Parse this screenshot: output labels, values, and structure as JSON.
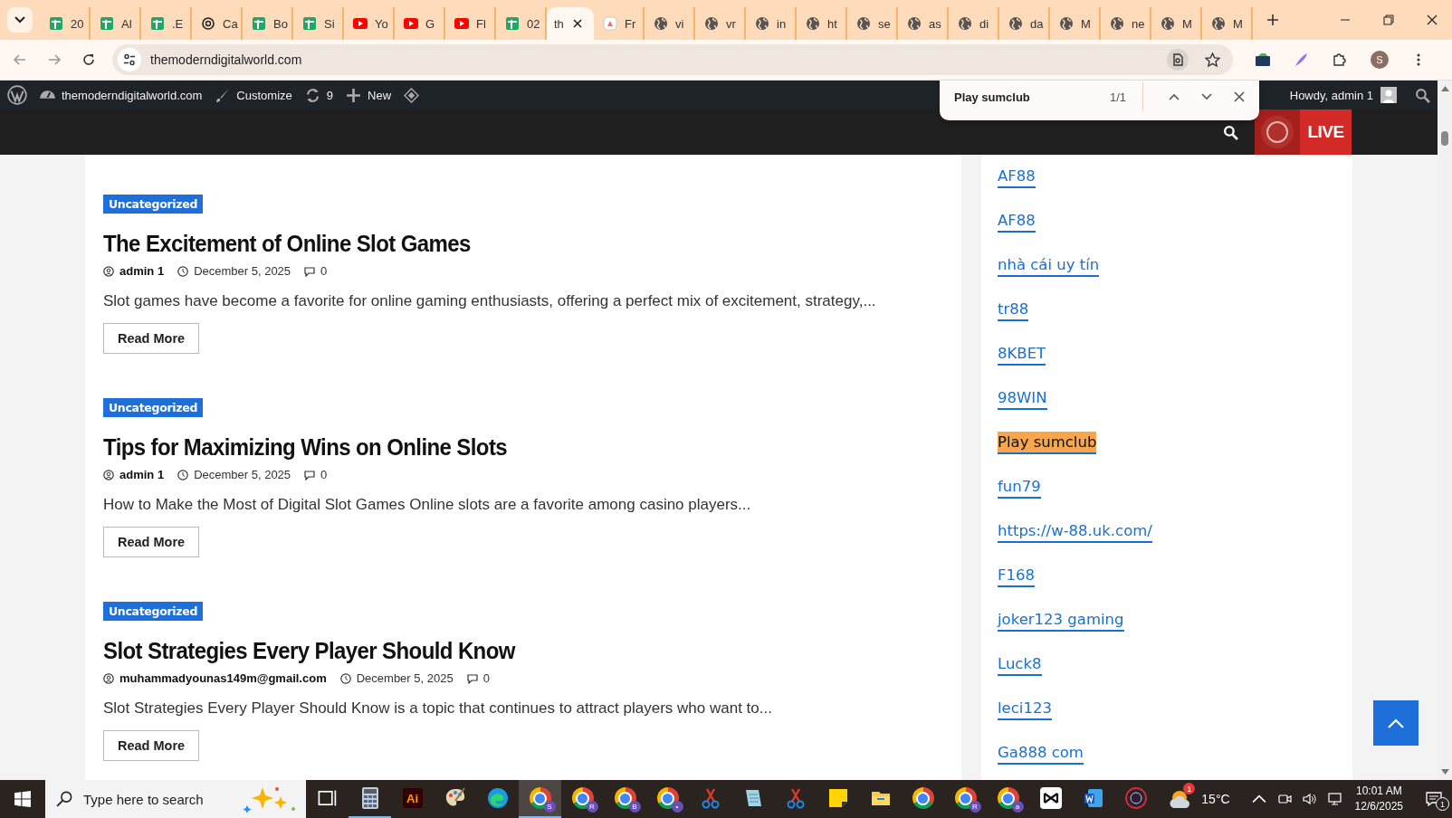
{
  "tabs": [
    {
      "kind": "sheets",
      "label": "20",
      "selected": false
    },
    {
      "kind": "sheets",
      "label": "Al",
      "selected": false
    },
    {
      "kind": "sheets",
      "label": ".E",
      "selected": false
    },
    {
      "kind": "knot",
      "label": "Ca",
      "selected": false
    },
    {
      "kind": "sheets",
      "label": "Bo",
      "selected": false
    },
    {
      "kind": "sheets",
      "label": "Si",
      "selected": false
    },
    {
      "kind": "video",
      "label": "Yo",
      "selected": false
    },
    {
      "kind": "video",
      "label": "G",
      "selected": false
    },
    {
      "kind": "video",
      "label": "Fl",
      "selected": false
    },
    {
      "kind": "sheets",
      "label": "02",
      "selected": false
    },
    {
      "kind": "page",
      "label": "th",
      "selected": true
    },
    {
      "kind": "doc",
      "label": "Fr",
      "selected": false
    },
    {
      "kind": "globe",
      "label": "vi",
      "selected": false
    },
    {
      "kind": "globe",
      "label": "vr",
      "selected": false
    },
    {
      "kind": "globe",
      "label": "in",
      "selected": false
    },
    {
      "kind": "globe",
      "label": "ht",
      "selected": false
    },
    {
      "kind": "globe",
      "label": "se",
      "selected": false
    },
    {
      "kind": "globe",
      "label": "as",
      "selected": false
    },
    {
      "kind": "globe",
      "label": "di",
      "selected": false
    },
    {
      "kind": "globe",
      "label": "da",
      "selected": false
    },
    {
      "kind": "globe",
      "label": "M",
      "selected": false
    },
    {
      "kind": "globe",
      "label": "ne",
      "selected": false
    },
    {
      "kind": "globe",
      "label": "M",
      "selected": false
    },
    {
      "kind": "globe",
      "label": "M",
      "selected": false
    }
  ],
  "address": {
    "url": "themoderndigitalworld.com",
    "profile_initial": "S"
  },
  "find_bar": {
    "query": "Play sumclub",
    "count": "1/1"
  },
  "admin_bar": {
    "site": "themoderndigitalworld.com",
    "customize": "Customize",
    "updates": "9",
    "new": "New",
    "greeting": "Howdy, admin 1"
  },
  "header": {
    "live": "LIVE"
  },
  "posts": [
    {
      "category": "Uncategorized",
      "title": "The Excitement of Online Slot Games",
      "author": "admin 1",
      "date": "December 5, 2025",
      "comments": "0",
      "excerpt": "Slot games have become a favorite for online gaming enthusiasts, offering a perfect mix of excitement, strategy,...",
      "button": "Read More"
    },
    {
      "category": "Uncategorized",
      "title": "Tips for Maximizing Wins on Online Slots",
      "author": "admin 1",
      "date": "December 5, 2025",
      "comments": "0",
      "excerpt": "How to Make the Most of Digital Slot Games Online slots are a favorite among casino players...",
      "button": "Read More"
    },
    {
      "category": "Uncategorized",
      "title": "Slot Strategies Every Player Should Know",
      "author": "muhammadyounas149m@gmail.com",
      "date": "December 5, 2025",
      "comments": "0",
      "excerpt": "Slot Strategies Every Player Should Know is a topic that continues to attract players who want to...",
      "button": "Read More"
    }
  ],
  "sidebar": {
    "links": [
      {
        "label": "AF88",
        "highlighted": false
      },
      {
        "label": "AF88",
        "highlighted": false
      },
      {
        "label": "nhà cái uy tín",
        "highlighted": false
      },
      {
        "label": "tr88",
        "highlighted": false
      },
      {
        "label": "8KBET",
        "highlighted": false
      },
      {
        "label": "98WIN",
        "highlighted": false
      },
      {
        "label": "Play sumclub",
        "highlighted": true
      },
      {
        "label": "fun79",
        "highlighted": false
      },
      {
        "label": "https://w-88.uk.com/",
        "highlighted": false
      },
      {
        "label": "F168",
        "highlighted": false
      },
      {
        "label": "joker123 gaming",
        "highlighted": false
      },
      {
        "label": "Luck8",
        "highlighted": false
      },
      {
        "label": "leci123",
        "highlighted": false
      },
      {
        "label": "Ga888 com",
        "highlighted": false
      }
    ]
  },
  "taskbar": {
    "search_placeholder": "Type here to search",
    "apps": [
      {
        "kind": "taskview",
        "running": false,
        "selected": false
      },
      {
        "kind": "calculator",
        "running": true,
        "selected": false
      },
      {
        "kind": "illustrator",
        "label": "Ai",
        "running": false,
        "selected": false
      },
      {
        "kind": "palette",
        "running": false,
        "selected": false
      },
      {
        "kind": "edge",
        "running": false,
        "selected": false
      },
      {
        "kind": "chrome",
        "badge": "S",
        "running": true,
        "selected": true
      },
      {
        "kind": "chrome",
        "badge": "R",
        "running": false,
        "selected": false
      },
      {
        "kind": "chrome",
        "badge": "B",
        "running": false,
        "selected": false
      },
      {
        "kind": "chrome",
        "badge": "•",
        "running": false,
        "selected": false
      },
      {
        "kind": "scissors",
        "running": false,
        "selected": false
      },
      {
        "kind": "notepad",
        "running": false,
        "selected": false
      },
      {
        "kind": "scissors",
        "running": false,
        "selected": false
      },
      {
        "kind": "sticky",
        "running": false,
        "selected": false
      },
      {
        "kind": "folder",
        "running": false,
        "selected": false
      },
      {
        "kind": "chrome",
        "running": false,
        "selected": false
      },
      {
        "kind": "chrome",
        "badge": "R",
        "running": false,
        "selected": false
      },
      {
        "kind": "chrome",
        "badge": "a",
        "running": false,
        "selected": false
      },
      {
        "kind": "capcut",
        "running": false,
        "selected": false
      },
      {
        "kind": "word",
        "running": false,
        "selected": false
      },
      {
        "kind": "roundlogo",
        "running": false,
        "selected": false
      }
    ],
    "weather_badge": "1",
    "temperature": "15°C",
    "time": "10:01 AM",
    "date": "12/6/2025",
    "notifications": "1"
  }
}
